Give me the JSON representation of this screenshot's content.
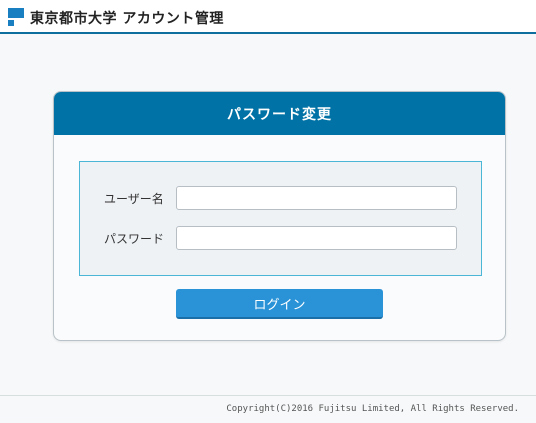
{
  "header": {
    "app_title": "東京都市大学 アカウント管理",
    "logo_icon": "university-logo-icon",
    "accent_color": "#0072a5"
  },
  "card": {
    "title": "パスワード変更",
    "username_label": "ユーザー名",
    "username_value": "",
    "password_label": "パスワード",
    "password_value": "",
    "login_button_label": "ログイン"
  },
  "footer": {
    "copyright": "Copyright(C)2016 Fujitsu Limited, All Rights Reserved."
  }
}
